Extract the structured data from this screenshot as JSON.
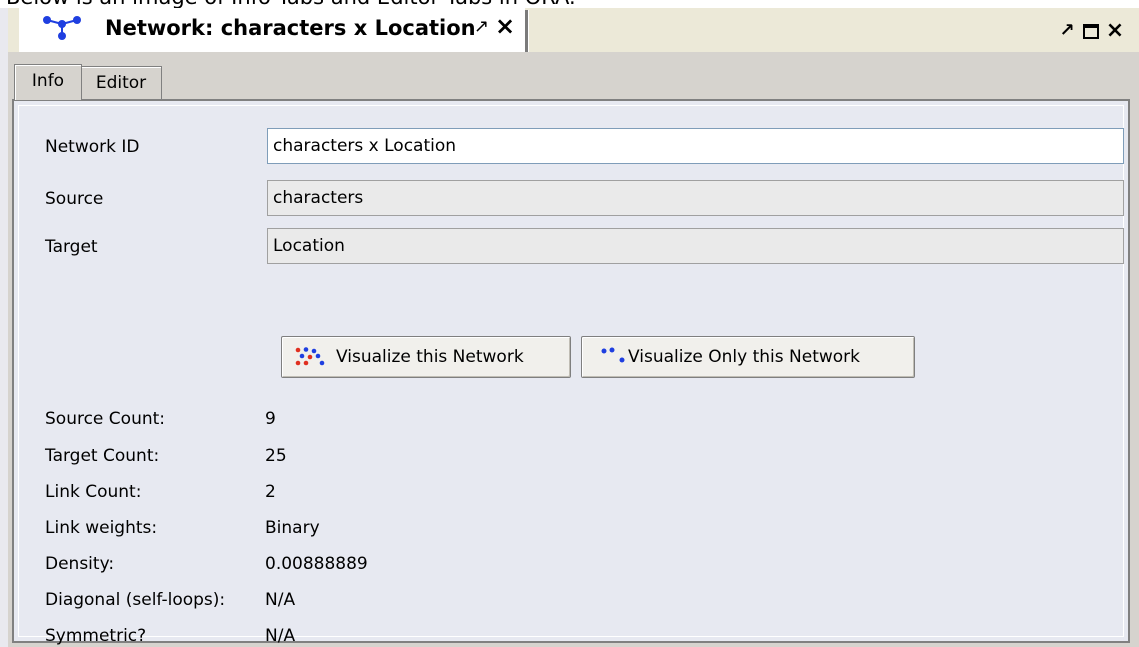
{
  "caption": "Below is an image of Info Tabs and Editor Tabs in ORA.",
  "window": {
    "tab_title": "Network: characters x Location",
    "pin_icon": "pin-icon",
    "close_icon": "close-icon",
    "controls": [
      "pin-icon",
      "maximize-icon",
      "close-icon"
    ]
  },
  "subtabs": [
    {
      "label": "Info",
      "active": true
    },
    {
      "label": "Editor",
      "active": false
    }
  ],
  "form": {
    "network_id": {
      "label": "Network ID",
      "value": "characters x Location"
    },
    "source": {
      "label": "Source",
      "value": "characters"
    },
    "target": {
      "label": "Target",
      "value": "Location"
    }
  },
  "buttons": {
    "visualize": "Visualize this Network",
    "visualize_only": "Visualize Only this Network"
  },
  "stats": [
    {
      "label": "Source Count:",
      "value": "9"
    },
    {
      "label": "Target Count:",
      "value": "25"
    },
    {
      "label": "Link Count:",
      "value": "2"
    },
    {
      "label": "Link weights:",
      "value": "Binary"
    },
    {
      "label": "Density:",
      "value": "0.00888889"
    },
    {
      "label": "Diagonal (self-loops):",
      "value": "N/A"
    },
    {
      "label": "Symmetric?",
      "value": "N/A"
    }
  ],
  "colors": {
    "panel_bg": "#e7e9f1",
    "window_bg": "#d6d3ce",
    "icon_blue": "#1f3fe0",
    "icon_red": "#e03020"
  }
}
